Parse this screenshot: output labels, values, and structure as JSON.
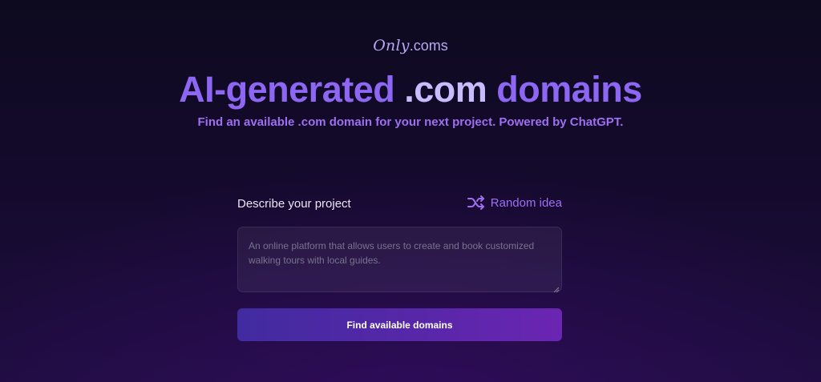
{
  "logo": {
    "only": "Only",
    "coms": ".coms"
  },
  "headline": {
    "part_a": "AI-generated ",
    "part_b": ".com",
    "part_c": " domains"
  },
  "subtitle": "Find an available .com domain for your next project. Powered by ChatGPT.",
  "form": {
    "label": "Describe your project",
    "random_label": "Random idea",
    "random_icon": "shuffle-icon",
    "placeholder": "An online platform that allows users to create and book customized walking tours with local guides.",
    "submit_label": "Find available domains"
  },
  "colors": {
    "accent": "#8d67f3",
    "accent_light": "#c7bdfc",
    "subtitle": "#9f6ff2",
    "button_start": "#412ba0",
    "button_end": "#6b25b2",
    "background": "#140a2c"
  }
}
